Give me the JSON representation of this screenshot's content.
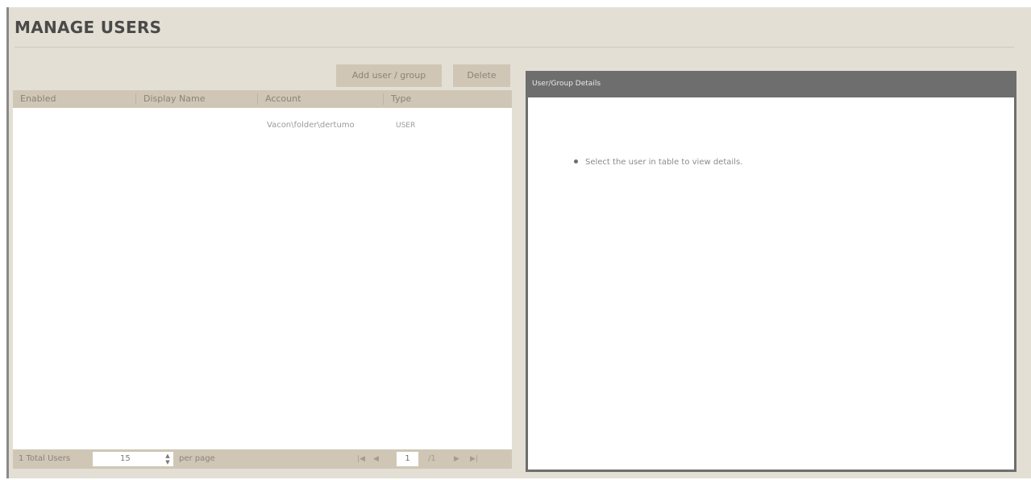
{
  "page": {
    "title": "MANAGE USERS"
  },
  "toolbar": {
    "add_label": "Add user / group",
    "delete_label": "Delete"
  },
  "table": {
    "columns": [
      "Enabled",
      "Display Name",
      "Account",
      "Type"
    ],
    "rows": [
      {
        "enabled": "",
        "display_name": "",
        "account": "Vacon\\folder\\dertumo",
        "type": "USER"
      }
    ]
  },
  "pager": {
    "total_label": "1 Total Users",
    "per_page_value": "15",
    "per_page_label": "per page",
    "current_page": "1",
    "page_of": "/1",
    "first_icon": "first-page-icon",
    "prev_icon": "prev-page-icon",
    "next_icon": "next-page-icon",
    "last_icon": "last-page-icon"
  },
  "details": {
    "title": "User/Group Details",
    "message": "Select the user in table to view details."
  },
  "colors": {
    "background": "#e4dfd5",
    "header": "#cfc6b5",
    "details_header": "#6e6e6e",
    "text": "#6d6d6d"
  }
}
